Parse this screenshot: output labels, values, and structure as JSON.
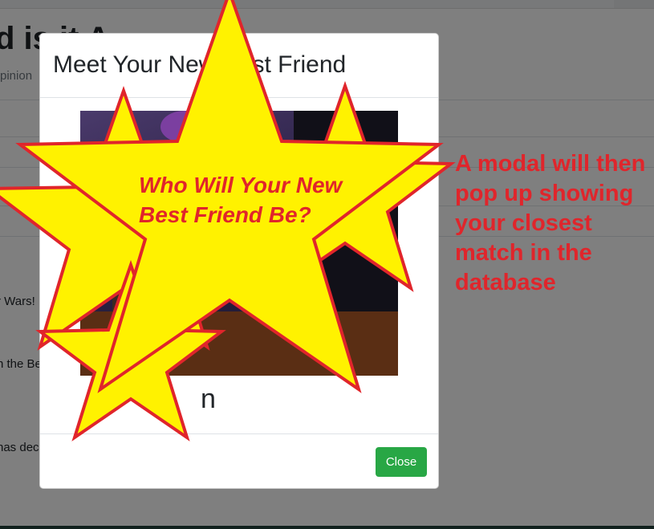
{
  "background_page": {
    "heading_fragment": "d is it A",
    "subtitle_fragment": "pinion",
    "rows": [
      "r Wars!",
      "n the Be",
      "has dec"
    ]
  },
  "modal": {
    "title": "Meet Your New Best Friend",
    "name_fragment": "n",
    "close_label": "Close"
  },
  "annotation": {
    "star_caption": "Who Will Your New Best Friend Be?",
    "side_note": "A modal will then pop up showing your closest match in the database",
    "colors": {
      "star_fill": "#fff200",
      "star_stroke": "#e0252b",
      "text": "#e0252b",
      "close_button": "#28a745"
    }
  }
}
